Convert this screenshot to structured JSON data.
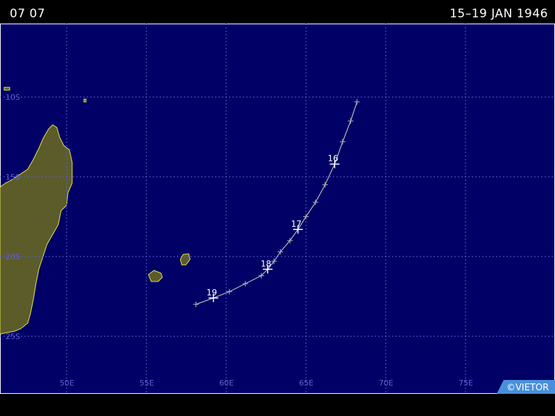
{
  "header": {
    "left_text": "07 07",
    "right_text": "15–19 JAN 1946"
  },
  "map": {
    "ocean_color": "#000066",
    "land_color": "#5c5c2a",
    "coast_color": "#e8e84a",
    "grid_color": "#5c5ce6",
    "track_color": "#b8b8b8",
    "lon_labels": [
      "50E",
      "55E",
      "60E",
      "65E",
      "70E",
      "75E"
    ],
    "lat_labels": [
      "10S",
      "15S",
      "20S",
      "25S"
    ],
    "track": {
      "points": [
        {
          "lon": 68.2,
          "lat": -10.3
        },
        {
          "lon": 67.8,
          "lat": -11.5
        },
        {
          "lon": 67.3,
          "lat": -12.8
        },
        {
          "lon": 66.8,
          "lat": -14.2
        },
        {
          "lon": 66.2,
          "lat": -15.5
        },
        {
          "lon": 65.6,
          "lat": -16.6
        },
        {
          "lon": 65.0,
          "lat": -17.5
        },
        {
          "lon": 64.5,
          "lat": -18.3
        },
        {
          "lon": 64.0,
          "lat": -19.0
        },
        {
          "lon": 63.4,
          "lat": -19.7
        },
        {
          "lon": 63.0,
          "lat": -20.3
        },
        {
          "lon": 62.6,
          "lat": -20.8
        },
        {
          "lon": 62.2,
          "lat": -21.2
        },
        {
          "lon": 61.2,
          "lat": -21.7
        },
        {
          "lon": 60.2,
          "lat": -22.2
        },
        {
          "lon": 59.2,
          "lat": -22.6
        },
        {
          "lon": 58.1,
          "lat": -23.0
        }
      ],
      "day_marks": [
        {
          "label": "16",
          "lon": 66.8,
          "lat": -14.2
        },
        {
          "label": "17",
          "lon": 64.5,
          "lat": -18.3
        },
        {
          "label": "18",
          "lon": 62.6,
          "lat": -20.8
        },
        {
          "label": "19",
          "lon": 59.2,
          "lat": -22.6
        }
      ]
    }
  },
  "footer": {
    "credit": "©VIETOR",
    "credit_bg": "#4a90d9"
  }
}
